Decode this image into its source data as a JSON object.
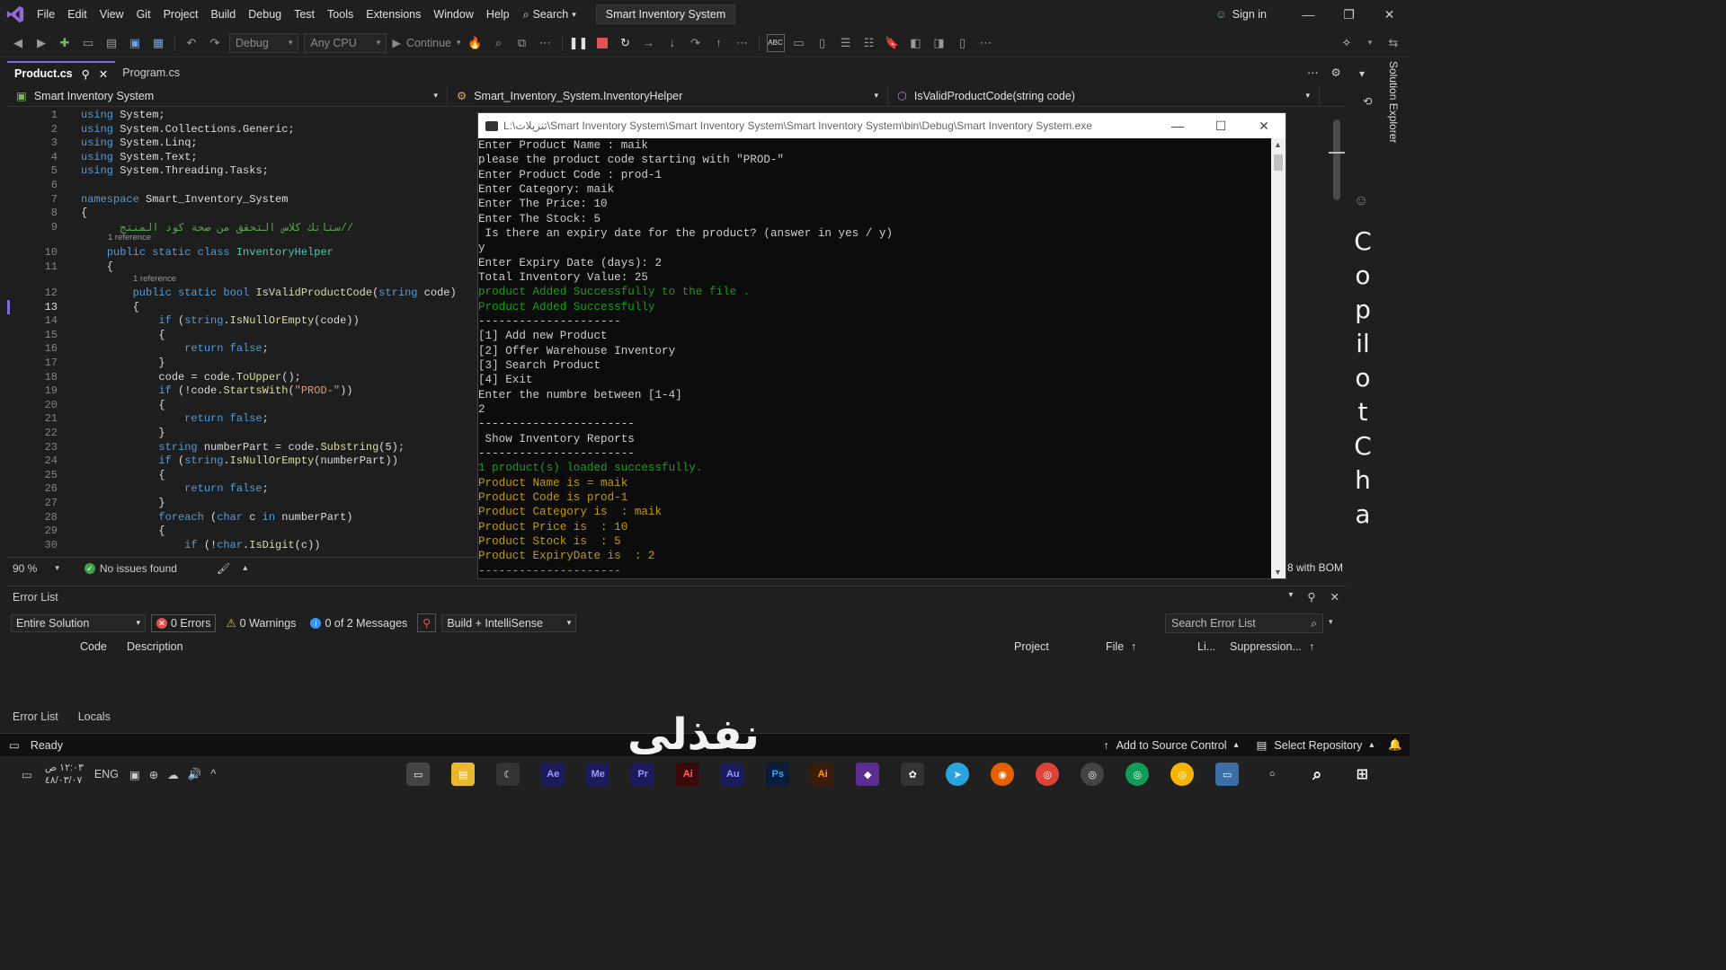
{
  "menu": [
    "File",
    "Edit",
    "View",
    "Git",
    "Project",
    "Build",
    "Debug",
    "Test",
    "Tools",
    "Extensions",
    "Window",
    "Help"
  ],
  "search_label": "Search",
  "solution_title": "Smart Inventory System",
  "sign_in": "Sign in",
  "toolbar": {
    "config": "Debug",
    "platform": "Any CPU",
    "continue": "Continue"
  },
  "tabs": [
    {
      "label": "Product.cs",
      "active": true
    },
    {
      "label": "Program.cs",
      "active": false
    }
  ],
  "nav": {
    "project": "Smart Inventory System",
    "class": "Smart_Inventory_System.InventoryHelper",
    "member": "IsValidProductCode(string code)"
  },
  "code_lines": [
    {
      "n": "1",
      "html": "<span class='kw'>using</span> System;"
    },
    {
      "n": "2",
      "html": "<span class='kw'>using</span> System.Collections.Generic;"
    },
    {
      "n": "3",
      "html": "<span class='kw'>using</span> System.Linq;"
    },
    {
      "n": "4",
      "html": "<span class='kw'>using</span> System.Text;"
    },
    {
      "n": "5",
      "html": "<span class='kw'>using</span> System.Threading.Tasks;"
    },
    {
      "n": "6",
      "html": ""
    },
    {
      "n": "7",
      "html": "<span class='kw'>namespace</span> Smart_Inventory_System"
    },
    {
      "n": "8",
      "html": "{"
    },
    {
      "n": "9",
      "html": "      <span class='cm'>ستاتك كلاس التحقق من صحة كود المنتج//</span>"
    },
    {
      "n": "10",
      "html": "    <span class='kw'>public static class</span> <span class='typ'>InventoryHelper</span>"
    },
    {
      "n": "11",
      "html": "    {"
    },
    {
      "n": "12",
      "html": "        <span class='kw'>public static bool</span> <span class='mth'>IsValidProductCode</span>(<span class='kw'>string</span> code)"
    },
    {
      "n": "13",
      "html": "        {"
    },
    {
      "n": "14",
      "html": "            <span class='kw'>if</span> (<span class='kw'>string</span>.<span class='mth'>IsNullOrEmpty</span>(code))"
    },
    {
      "n": "15",
      "html": "            {"
    },
    {
      "n": "16",
      "html": "                <span class='kw'>return false</span>;"
    },
    {
      "n": "17",
      "html": "            }"
    },
    {
      "n": "18",
      "html": "            code = code.<span class='mth'>ToUpper</span>();"
    },
    {
      "n": "19",
      "html": "            <span class='kw'>if</span> (!code.<span class='mth'>StartsWith</span>(<span class='str'>\"PROD-\"</span>))"
    },
    {
      "n": "20",
      "html": "            {"
    },
    {
      "n": "21",
      "html": "                <span class='kw'>return false</span>;"
    },
    {
      "n": "22",
      "html": "            }"
    },
    {
      "n": "23",
      "html": "            <span class='kw'>string</span> numberPart = code.<span class='mth'>Substring</span>(5);"
    },
    {
      "n": "24",
      "html": "            <span class='kw'>if</span> (<span class='kw'>string</span>.<span class='mth'>IsNullOrEmpty</span>(numberPart))"
    },
    {
      "n": "25",
      "html": "            {"
    },
    {
      "n": "26",
      "html": "                <span class='kw'>return false</span>;"
    },
    {
      "n": "27",
      "html": "            }"
    },
    {
      "n": "28",
      "html": "            <span class='kw'>foreach</span> (<span class='kw'>char</span> c <span class='kw'>in</span> numberPart)"
    },
    {
      "n": "29",
      "html": "            {"
    },
    {
      "n": "30",
      "html": "                <span class='kw'>if</span> (!<span class='kw'>char</span>.<span class='mth'>IsDigit</span>(c))"
    }
  ],
  "references": {
    "class_refs": "1 reference",
    "method_refs": "1 reference"
  },
  "zoom": "90 %",
  "no_issues": "No issues found",
  "encoding_partial": "8 with BOM",
  "console": {
    "title": "L:\\تنزيلات\\Smart Inventory System\\Smart Inventory System\\Smart Inventory System\\bin\\Debug\\Smart Inventory System.exe",
    "lines": [
      {
        "t": "Enter Product Name : maik",
        "c": ""
      },
      {
        "t": "please the product code starting with \"PROD-\"",
        "c": ""
      },
      {
        "t": "Enter Product Code : prod-1",
        "c": ""
      },
      {
        "t": "Enter Category: maik",
        "c": ""
      },
      {
        "t": "Enter The Price: 10",
        "c": ""
      },
      {
        "t": "Enter The Stock: 5",
        "c": ""
      },
      {
        "t": " Is there an expiry date for the product? (answer in yes / y)",
        "c": ""
      },
      {
        "t": "y",
        "c": ""
      },
      {
        "t": "Enter Expiry Date (days): 2",
        "c": ""
      },
      {
        "t": "Total Inventory Value: 25",
        "c": ""
      },
      {
        "t": "product Added Successfully to the file .",
        "c": "green"
      },
      {
        "t": "Product Added Successfully",
        "c": "green"
      },
      {
        "t": "---------------------",
        "c": ""
      },
      {
        "t": "[1] Add new Product",
        "c": ""
      },
      {
        "t": "[2] Offer Warehouse Inventory",
        "c": ""
      },
      {
        "t": "[3] Search Product",
        "c": ""
      },
      {
        "t": "[4] Exit",
        "c": ""
      },
      {
        "t": "Enter the numbre between [1-4]",
        "c": ""
      },
      {
        "t": "2",
        "c": ""
      },
      {
        "t": "-----------------------",
        "c": ""
      },
      {
        "t": " Show Inventory Reports",
        "c": ""
      },
      {
        "t": "-----------------------",
        "c": ""
      },
      {
        "t": "1 product(s) loaded successfully.",
        "c": "green"
      },
      {
        "t": "Product Name is = maik",
        "c": "yellow"
      },
      {
        "t": "Product Code is prod-1",
        "c": "yellow"
      },
      {
        "t": "Product Category is  : maik",
        "c": "yellow"
      },
      {
        "t": "Product Price is  : 10",
        "c": "yellow"
      },
      {
        "t": "Product Stock is  : 5",
        "c": "yellow"
      },
      {
        "t": "Product ExpiryDate is  : 2",
        "c": "yellow"
      },
      {
        "t": "---------------------",
        "c": "yellow"
      }
    ]
  },
  "copilot_letters": [
    "C",
    "o",
    "p",
    "il",
    "o",
    "t",
    "C",
    "h",
    "a"
  ],
  "solution_explorer": "Solution Explorer",
  "error_list": {
    "title": "Error List",
    "scope": "Entire Solution",
    "errors": "0 Errors",
    "warnings": "0 Warnings",
    "messages": "0 of 2 Messages",
    "build_filter": "Build + IntelliSense",
    "search_placeholder": "Search Error List",
    "columns": [
      "Code",
      "Description",
      "Project",
      "File",
      "Li...",
      "Suppression..."
    ],
    "bottom_tabs": [
      "Error List",
      "Locals"
    ]
  },
  "status": {
    "ready": "Ready",
    "source_control": "Add to Source Control",
    "repository": "Select Repository"
  },
  "taskbar": {
    "time": "١٢:٠٣ ص",
    "date": "٤٨/٠٣/٠٧",
    "lang": "ENG"
  },
  "watermark": "نفذلي",
  "colors": {
    "accent": "#7f6cd8",
    "console_green": "#13a10e",
    "console_yellow": "#c19c00",
    "error_red": "#e05252"
  }
}
